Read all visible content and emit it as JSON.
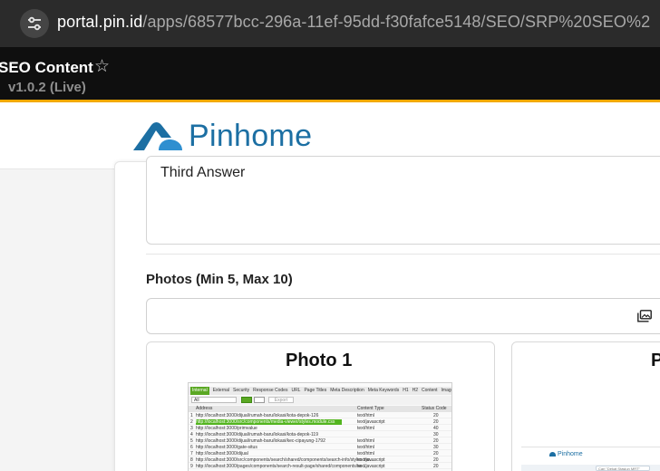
{
  "browser": {
    "url_host": "portal.pin.id",
    "url_path": "/apps/68577bcc-296a-11ef-95dd-f30fafce5148/SEO/SRP%20SEO%2",
    "site_info_icon": "tune-icon"
  },
  "app": {
    "title": "SEO Content",
    "version": "v1.0.2 (Live)",
    "accent_color": "#f2a900",
    "star_icon": "☆"
  },
  "brand": {
    "name": "Pinhome",
    "color": "#1c6fa3"
  },
  "form": {
    "answer_value": "Third Answer",
    "photos_label": "Photos (Min 5, Max 10)",
    "upload_icon": "images-icon",
    "photo_cards": [
      {
        "title": "Photo 1"
      },
      {
        "title": "P"
      }
    ]
  },
  "thumbnail_1": {
    "tabs": [
      "Internal",
      "External",
      "Security",
      "Response Codes",
      "URL",
      "Page Titles",
      "Meta Description",
      "Meta Keywords",
      "H1",
      "H2",
      "Content",
      "Images"
    ],
    "filter_value": "All",
    "export_label": "Export",
    "columns": [
      "Address",
      "Content Type",
      "Status Code"
    ],
    "rows": [
      {
        "num": "1",
        "address": "http://localhost:3000/dijual/rumah-baru/lokasi/kota-depok-126",
        "type": "text/html",
        "status": "20"
      },
      {
        "num": "2",
        "address": "http://localhost:3000/src/components/media-viewer/styles.module.css",
        "type": "text/javascript",
        "status": "20"
      },
      {
        "num": "3",
        "address": "http://localhost:3000/primvalue",
        "type": "text/html",
        "status": "40"
      },
      {
        "num": "4",
        "address": "http://localhost:3000/dijual/rumah-baru/lokasi/kota-depok-119",
        "type": "",
        "status": "30"
      },
      {
        "num": "5",
        "address": "http://localhost:3000/dijual/rumah-baru/lokasi/kec-cipayung-1792",
        "type": "text/html",
        "status": "20"
      },
      {
        "num": "6",
        "address": "http://localhost:3000/gate-situs",
        "type": "text/html",
        "status": "30"
      },
      {
        "num": "7",
        "address": "http://localhost:3000/dijual",
        "type": "text/html",
        "status": "20"
      },
      {
        "num": "8",
        "address": "http://localhost:3000/src/components/search/shared/components/search-info/styles.mo...",
        "type": "text/javascript",
        "status": "20"
      },
      {
        "num": "9",
        "address": "http://localhost:3000/pages/components/search-result-page/shared/components/se...",
        "type": "text/javascript",
        "status": "20"
      }
    ]
  },
  "thumbnail_2": {
    "logo_text": "Pinhome",
    "search_text": "Cari \"Dekat Stasiun MRT\""
  }
}
